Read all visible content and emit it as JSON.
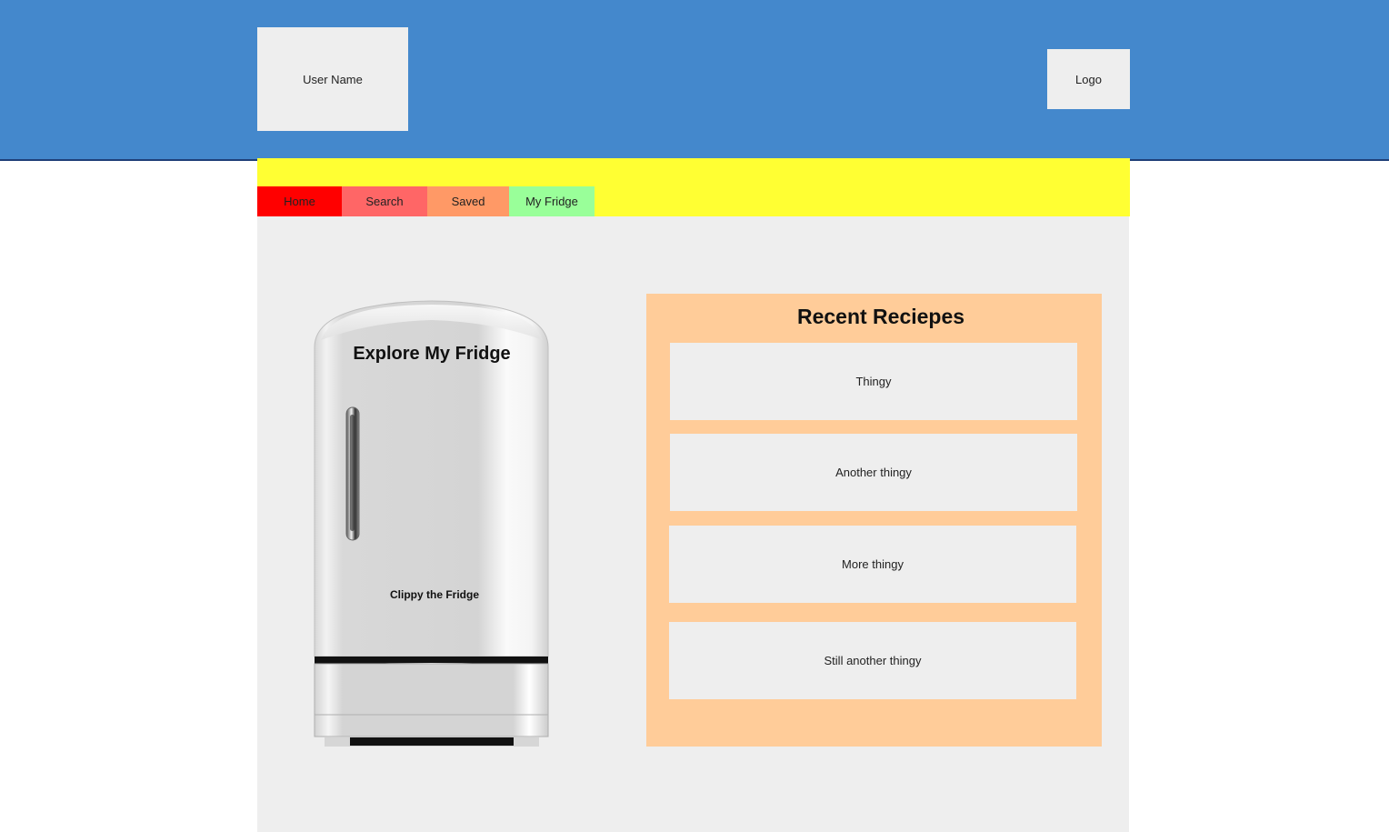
{
  "header": {
    "user_name": "User Name",
    "logo": "Logo"
  },
  "nav": {
    "tabs": [
      {
        "label": "Home",
        "color": "#FF0000"
      },
      {
        "label": "Search",
        "color": "#FF6666"
      },
      {
        "label": "Saved",
        "color": "#FF9966"
      },
      {
        "label": "My Fridge",
        "color": "#99FF99"
      }
    ]
  },
  "fridge": {
    "title": "Explore My Fridge",
    "caption": "Clippy the Fridge"
  },
  "recent": {
    "title": "Recent Reciepes",
    "items": [
      {
        "label": "Thingy"
      },
      {
        "label": "Another thingy"
      },
      {
        "label": "More thingy"
      },
      {
        "label": "Still another thingy"
      }
    ]
  },
  "colors": {
    "header_bg": "#4488CC",
    "yellow_bar": "#FFFF33",
    "panel_bg": "#FFCC99",
    "content_bg": "#EEEEEE"
  }
}
